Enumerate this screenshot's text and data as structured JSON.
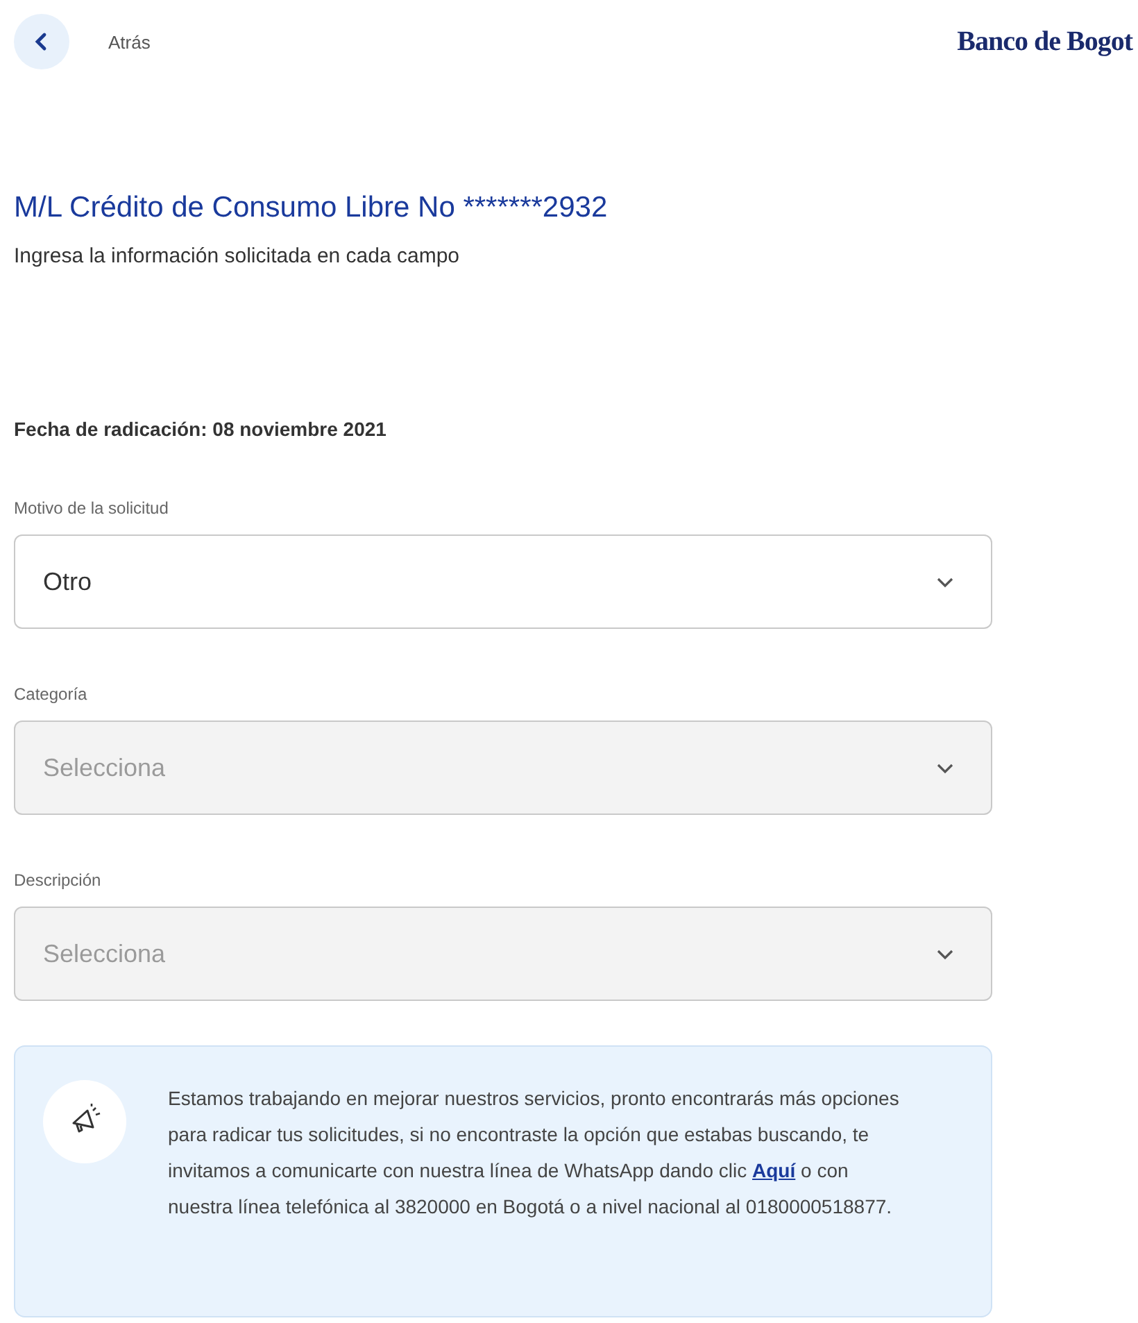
{
  "header": {
    "back_label": "Atrás",
    "logo": "Banco de Bogot"
  },
  "title": "M/L Crédito de Consumo Libre No *******2932",
  "subtitle": "Ingresa la información solicitada en cada campo",
  "filing_date": "Fecha de radicación: 08 noviembre 2021",
  "fields": [
    {
      "label": "Motivo de la solicitud",
      "value": "Otro",
      "disabled": false
    },
    {
      "label": "Categoría",
      "placeholder": "Selecciona",
      "disabled": true
    },
    {
      "label": "Descripción",
      "placeholder": "Selecciona",
      "disabled": true
    }
  ],
  "notice": {
    "text_before": "Estamos trabajando en mejorar nuestros servicios, pronto encontrarás más opciones para radicar tus solicitudes, si no encontraste la opción que estabas buscando, te invitamos a comunicarte con nuestra línea de WhatsApp dando clic",
    "link": "Aquí",
    "text_after": "o con nuestra línea telefónica al 3820000 en Bogotá o a nivel nacional al 0180000518877."
  }
}
